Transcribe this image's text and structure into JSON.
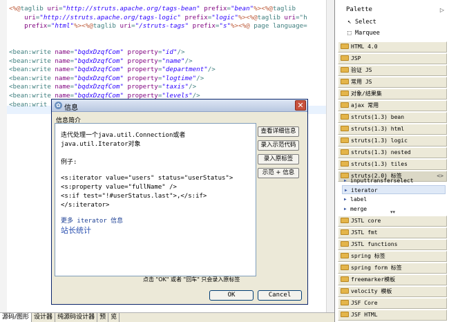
{
  "editor": {
    "lines": [
      [
        [
          "dir",
          "<%@"
        ],
        [
          "tag",
          "taglib "
        ],
        [
          "attr",
          "uri"
        ],
        [
          "tag",
          "="
        ],
        [
          "val",
          "\"http://struts.apache.org/tags-bean\""
        ],
        [
          "tag",
          " "
        ],
        [
          "attr",
          "prefix"
        ],
        [
          "tag",
          "="
        ],
        [
          "val",
          "\"bean\""
        ],
        [
          "dir",
          "%><%@"
        ],
        [
          "tag",
          "taglib"
        ]
      ],
      [
        [
          "tag",
          "    "
        ],
        [
          "attr",
          "uri"
        ],
        [
          "tag",
          "="
        ],
        [
          "val",
          "\"http://struts.apache.org/tags-logic\""
        ],
        [
          "tag",
          " "
        ],
        [
          "attr",
          "prefix"
        ],
        [
          "tag",
          "="
        ],
        [
          "val",
          "\"logic\""
        ],
        [
          "dir",
          "%><%@"
        ],
        [
          "tag",
          "taglib "
        ],
        [
          "attr",
          "uri"
        ],
        [
          "tag",
          "=\"h"
        ]
      ],
      [
        [
          "tag",
          "    "
        ],
        [
          "attr",
          "prefix"
        ],
        [
          "tag",
          "="
        ],
        [
          "val",
          "\"html\""
        ],
        [
          "dir",
          "%><%@"
        ],
        [
          "tag",
          "taglib "
        ],
        [
          "attr",
          "uri"
        ],
        [
          "tag",
          "="
        ],
        [
          "val",
          "\"/struts-tags\""
        ],
        [
          "tag",
          " "
        ],
        [
          "attr",
          "prefix"
        ],
        [
          "tag",
          "="
        ],
        [
          "val",
          "\"s\""
        ],
        [
          "dir",
          "%><%@"
        ],
        [
          "tag",
          " page language="
        ]
      ],
      [],
      [],
      [
        [
          "tag",
          "<bean:write "
        ],
        [
          "attr",
          "name"
        ],
        [
          "tag",
          "="
        ],
        [
          "val",
          "\"bqdxDzqfCom\""
        ],
        [
          "tag",
          " "
        ],
        [
          "attr",
          "property"
        ],
        [
          "tag",
          "="
        ],
        [
          "val",
          "\"id\""
        ],
        [
          "tag",
          "/>"
        ]
      ],
      [
        [
          "tag",
          "<bean:write "
        ],
        [
          "attr",
          "name"
        ],
        [
          "tag",
          "="
        ],
        [
          "val",
          "\"bqdxDzqfCom\""
        ],
        [
          "tag",
          " "
        ],
        [
          "attr",
          "property"
        ],
        [
          "tag",
          "="
        ],
        [
          "val",
          "\"name\""
        ],
        [
          "tag",
          "/>"
        ]
      ],
      [
        [
          "tag",
          "<bean:write "
        ],
        [
          "attr",
          "name"
        ],
        [
          "tag",
          "="
        ],
        [
          "val",
          "\"bqdxDzqfCom\""
        ],
        [
          "tag",
          " "
        ],
        [
          "attr",
          "property"
        ],
        [
          "tag",
          "="
        ],
        [
          "val",
          "\"department\""
        ],
        [
          "tag",
          "/>"
        ]
      ],
      [
        [
          "tag",
          "<bean:write "
        ],
        [
          "attr",
          "name"
        ],
        [
          "tag",
          "="
        ],
        [
          "val",
          "\"bqdxDzqfCom\""
        ],
        [
          "tag",
          " "
        ],
        [
          "attr",
          "property"
        ],
        [
          "tag",
          "="
        ],
        [
          "val",
          "\"logtime\""
        ],
        [
          "tag",
          "/>"
        ]
      ],
      [
        [
          "tag",
          "<bean:write "
        ],
        [
          "attr",
          "name"
        ],
        [
          "tag",
          "="
        ],
        [
          "val",
          "\"bqdxDzqfCom\""
        ],
        [
          "tag",
          " "
        ],
        [
          "attr",
          "property"
        ],
        [
          "tag",
          "="
        ],
        [
          "val",
          "\"taxis\""
        ],
        [
          "tag",
          "/>"
        ]
      ],
      [
        [
          "tag",
          "<bean:write "
        ],
        [
          "attr",
          "name"
        ],
        [
          "tag",
          "="
        ],
        [
          "val",
          "\"bqdxDzqfCom\""
        ],
        [
          "tag",
          " "
        ],
        [
          "attr",
          "property"
        ],
        [
          "tag",
          "="
        ],
        [
          "val",
          "\"levels\""
        ],
        [
          "tag",
          "/>"
        ]
      ],
      [
        [
          "tag",
          "<bean:writ"
        ]
      ]
    ]
  },
  "tabs": [
    "源码/图形",
    "设计器",
    "纯源码设计器",
    "预",
    "览"
  ],
  "palette": {
    "title": "Palette",
    "tools": [
      {
        "label": "Select",
        "icon": "↖"
      },
      {
        "label": "Marquee",
        "icon": "⬚"
      }
    ],
    "drawers_top": [
      "HTML 4.0",
      "JSP",
      "验证 JS",
      "常用 JS",
      "对象/结果集",
      "ajax 常用",
      "struts(1.3) bean",
      "struts(1.3) html",
      "struts(1.3) logic",
      "struts(1.3) nested",
      "struts(1.3) tiles"
    ],
    "open_drawer": {
      "label": "struts(2.0) 标签",
      "extra": "<>"
    },
    "open_items": [
      "inputtransferselect",
      "iterator",
      "label",
      "merge"
    ],
    "selected_item": "iterator",
    "drawers_bottom": [
      "JSTL core",
      "JSTL fmt",
      "JSTL functions",
      "spring 标签",
      "spring form 标签",
      "freemarker模板",
      "velocity 模板",
      "JSF Core",
      "JSF HTML"
    ]
  },
  "dialog": {
    "title": "信息",
    "section": "信息简介",
    "content": {
      "desc1": "迭代处理一个java.util.Connection或者",
      "desc2": "java.util.Iterator对象",
      "example_label": "例子:",
      "code": [
        "<s:iterator value=\"users\" status=\"userStatus\">",
        "  <s:property value=\"fullName\" />",
        "  <s:if test=\"!#userStatus.last\">,</s:if>",
        "</s:iterator>"
      ],
      "more_link": "更多 iterator 信息",
      "stats_link": "站长统计"
    },
    "side_buttons": [
      "查看详细信息",
      "录入示范代码",
      "录入原标签",
      "示范 + 信息"
    ],
    "hint": "点击 \"OK\" 或者 \"回车\"  只会录入原标签",
    "ok_label": "OK",
    "cancel_label": "Cancel"
  }
}
